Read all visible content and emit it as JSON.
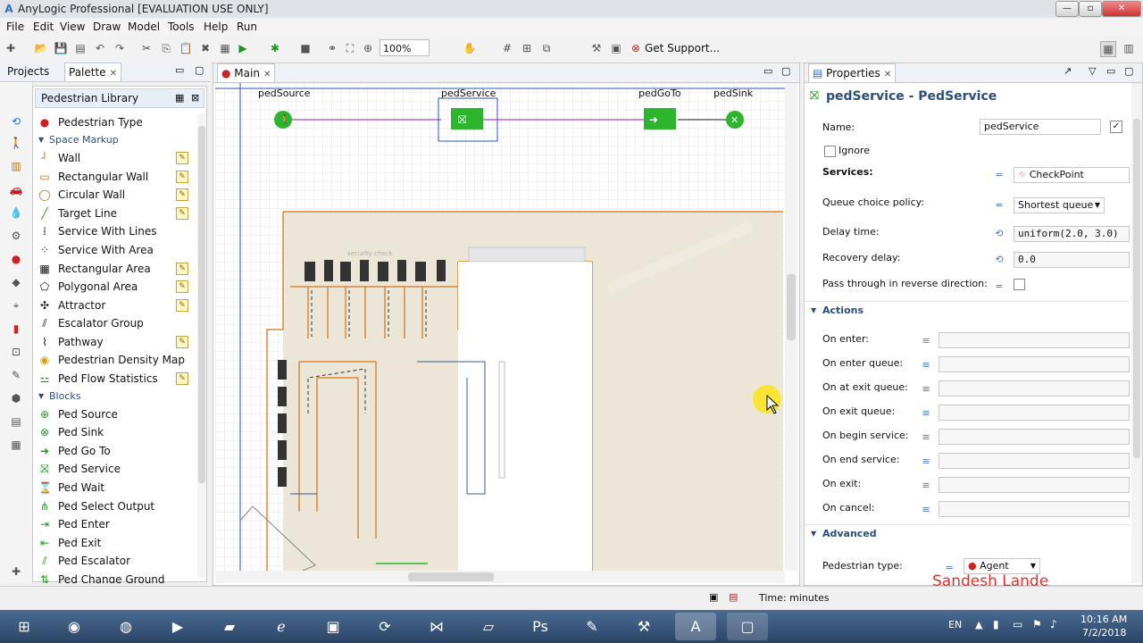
{
  "window": {
    "title": "AnyLogic Professional [EVALUATION USE ONLY]"
  },
  "menu": [
    "File",
    "Edit",
    "View",
    "Draw",
    "Model",
    "Tools",
    "Help",
    "Run"
  ],
  "toolbar": {
    "zoom": "100%",
    "support": "Get Support..."
  },
  "left_tabs": {
    "projects": "Projects",
    "palette": "Palette"
  },
  "palette": {
    "library": "Pedestrian Library",
    "pedestrian_type": "Pedestrian Type",
    "space_markup": "Space Markup",
    "markup_items": [
      "Wall",
      "Rectangular Wall",
      "Circular Wall",
      "Target Line",
      "Service With Lines",
      "Service With Area",
      "Rectangular Area",
      "Polygonal Area",
      "Attractor",
      "Escalator Group",
      "Pathway",
      "Pedestrian Density Map",
      "Ped Flow Statistics"
    ],
    "blocks": "Blocks",
    "block_items": [
      "Ped Source",
      "Ped Sink",
      "Ped Go To",
      "Ped Service",
      "Ped Wait",
      "Ped Select Output",
      "Ped Enter",
      "Ped Exit",
      "Ped Escalator",
      "Ped Change Ground"
    ]
  },
  "main": {
    "tab": "Main",
    "blocks": [
      {
        "label": "pedSource"
      },
      {
        "label": "pedService"
      },
      {
        "label": "pedGoTo"
      },
      {
        "label": "pedSink"
      }
    ],
    "area_label": "security check"
  },
  "properties": {
    "tab": "Properties",
    "header": "pedService - PedService",
    "name_label": "Name:",
    "name_value": "pedService",
    "ignore_label": "Ignore",
    "services_label": "Services:",
    "services_value": "CheckPoint",
    "queue_policy_label": "Queue choice policy:",
    "queue_policy_value": "Shortest queue",
    "delay_label": "Delay time:",
    "delay_value": "uniform(2.0, 3.0)",
    "recovery_label": "Recovery delay:",
    "recovery_value": "0.0",
    "reverse_label": "Pass through in reverse direction:",
    "actions_label": "Actions",
    "actions": [
      "On enter:",
      "On enter queue:",
      "On at exit queue:",
      "On exit queue:",
      "On begin service:",
      "On end service:",
      "On exit:",
      "On cancel:"
    ],
    "advanced_label": "Advanced",
    "ped_type_label": "Pedestrian type:",
    "ped_type_value": "Agent"
  },
  "status": {
    "time": "Time: minutes"
  },
  "watermark": "Sandesh Lande",
  "taskbar": {
    "lang": "EN",
    "time": "10:16 AM",
    "date": "7/2/2018"
  },
  "colors": {
    "block_green": "#2db52d",
    "wall_orange": "#d9893a",
    "link_purple": "#a020c8",
    "accent_blue": "#2a4d7a"
  }
}
